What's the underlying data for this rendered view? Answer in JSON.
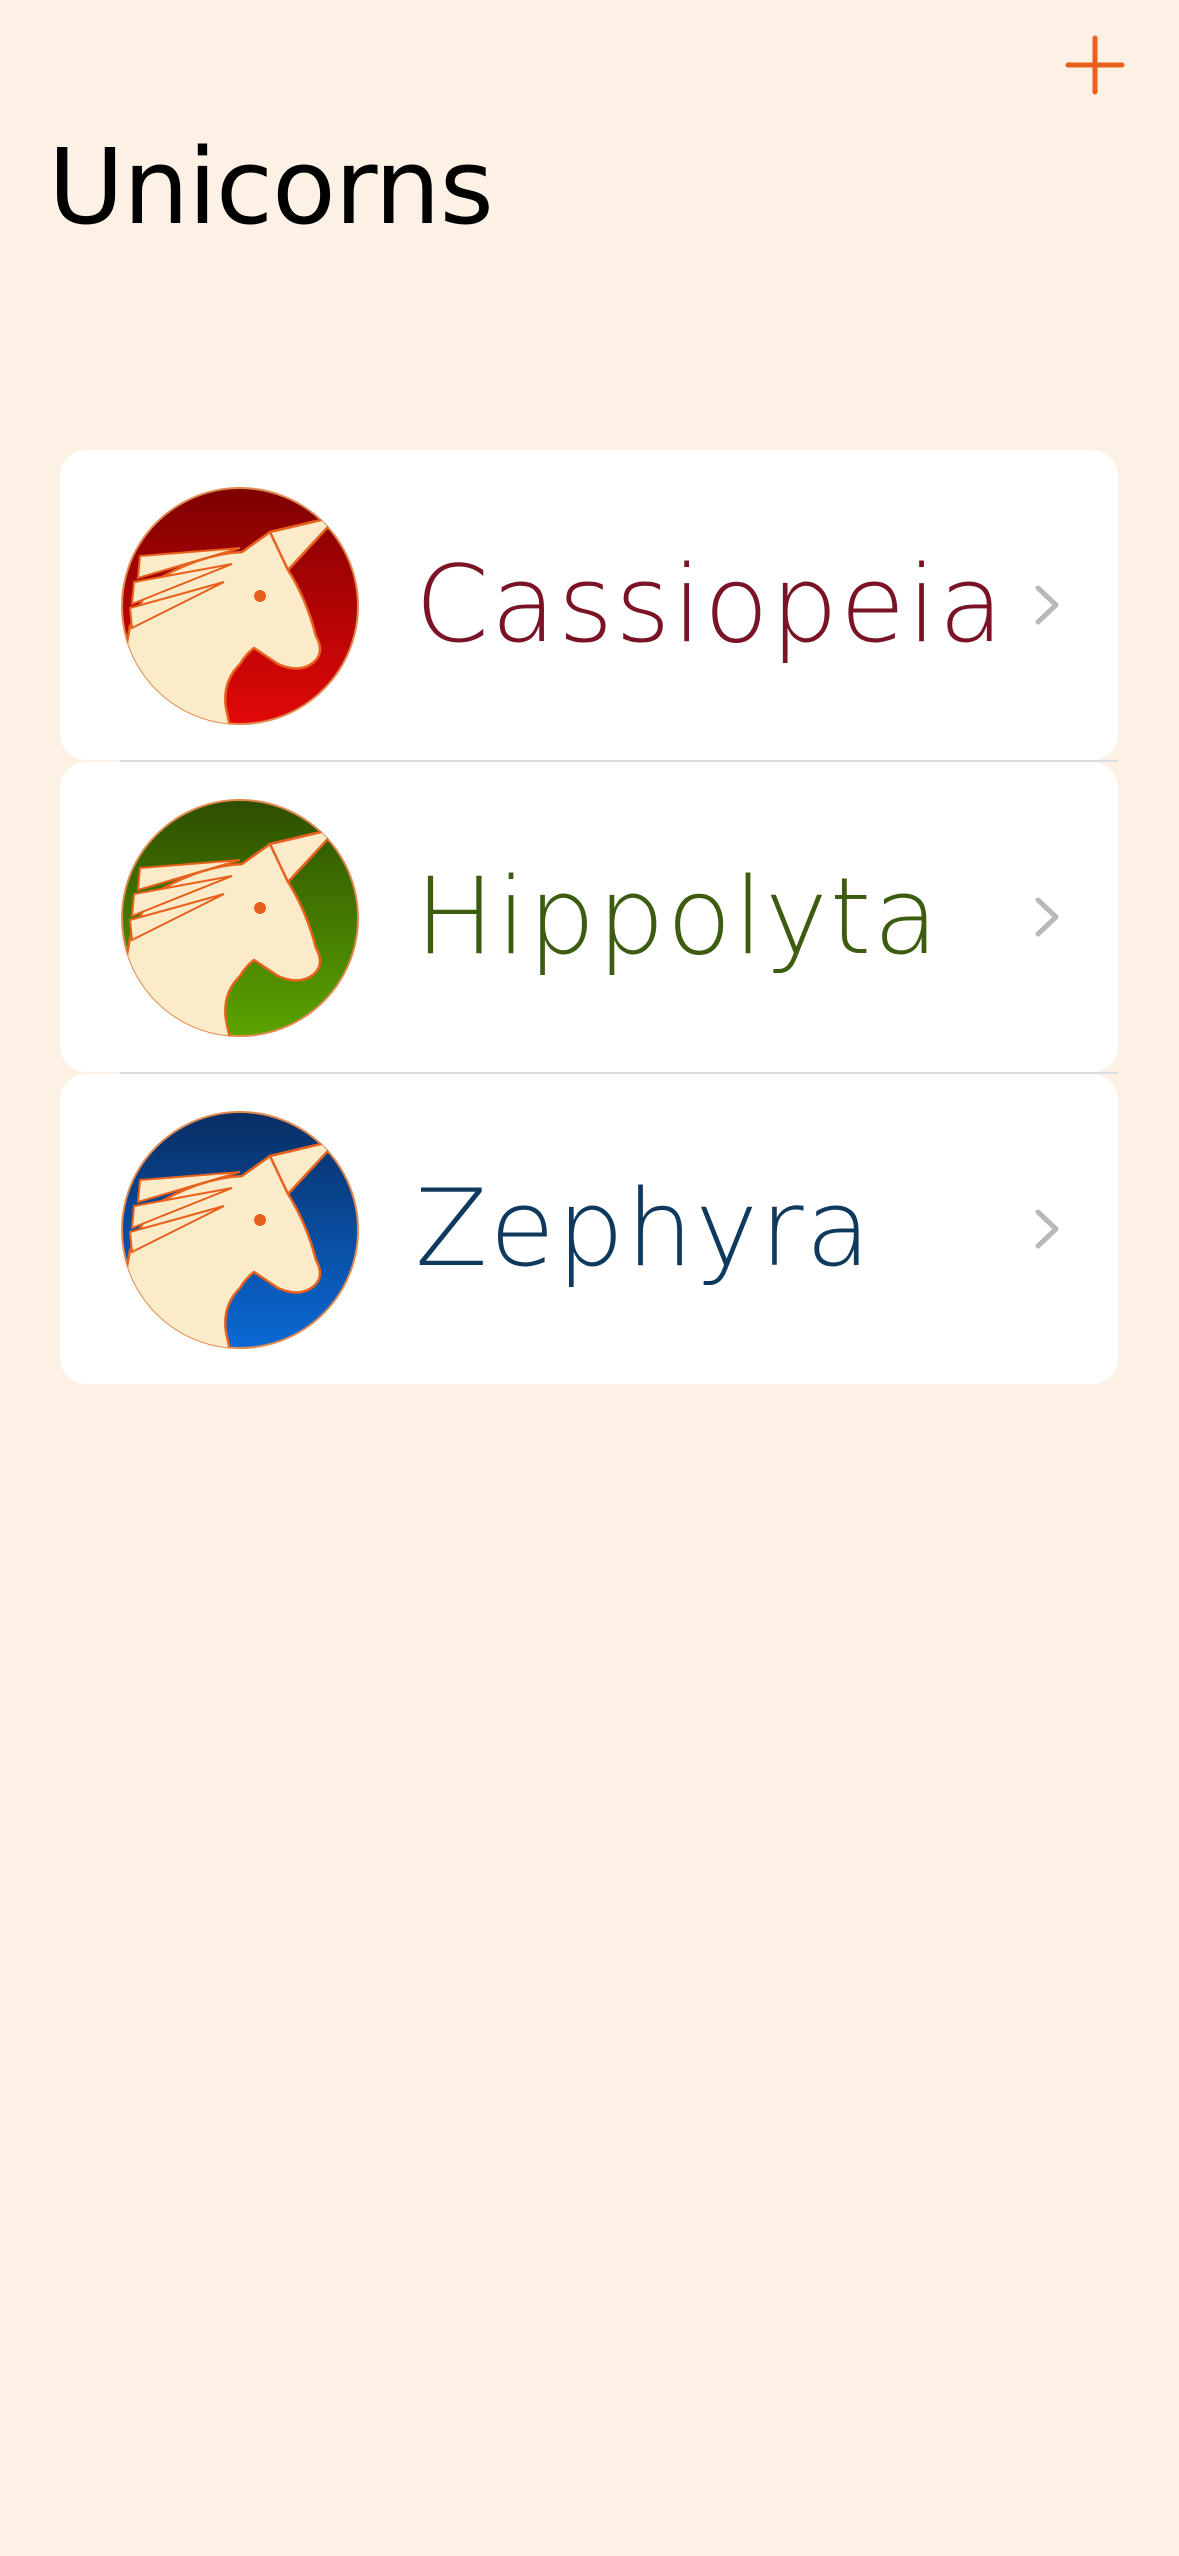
{
  "header": {
    "title": "Unicorns",
    "add_icon": "plus-icon",
    "accent_color": "#e8601c"
  },
  "unicorns": [
    {
      "name": "Cassiopeia",
      "name_color": "#7a1326",
      "icon": "unicorn-head-icon",
      "gradient": [
        "#7e0000",
        "#e30808"
      ]
    },
    {
      "name": "Hippolyta",
      "name_color": "#3c5c10",
      "icon": "unicorn-head-icon",
      "gradient": [
        "#2d4e00",
        "#5aa400"
      ]
    },
    {
      "name": "Zephyra",
      "name_color": "#0f3a5e",
      "icon": "unicorn-head-icon",
      "gradient": [
        "#082e63",
        "#0b69d6"
      ]
    }
  ],
  "chevron_icon": "chevron-right-icon"
}
